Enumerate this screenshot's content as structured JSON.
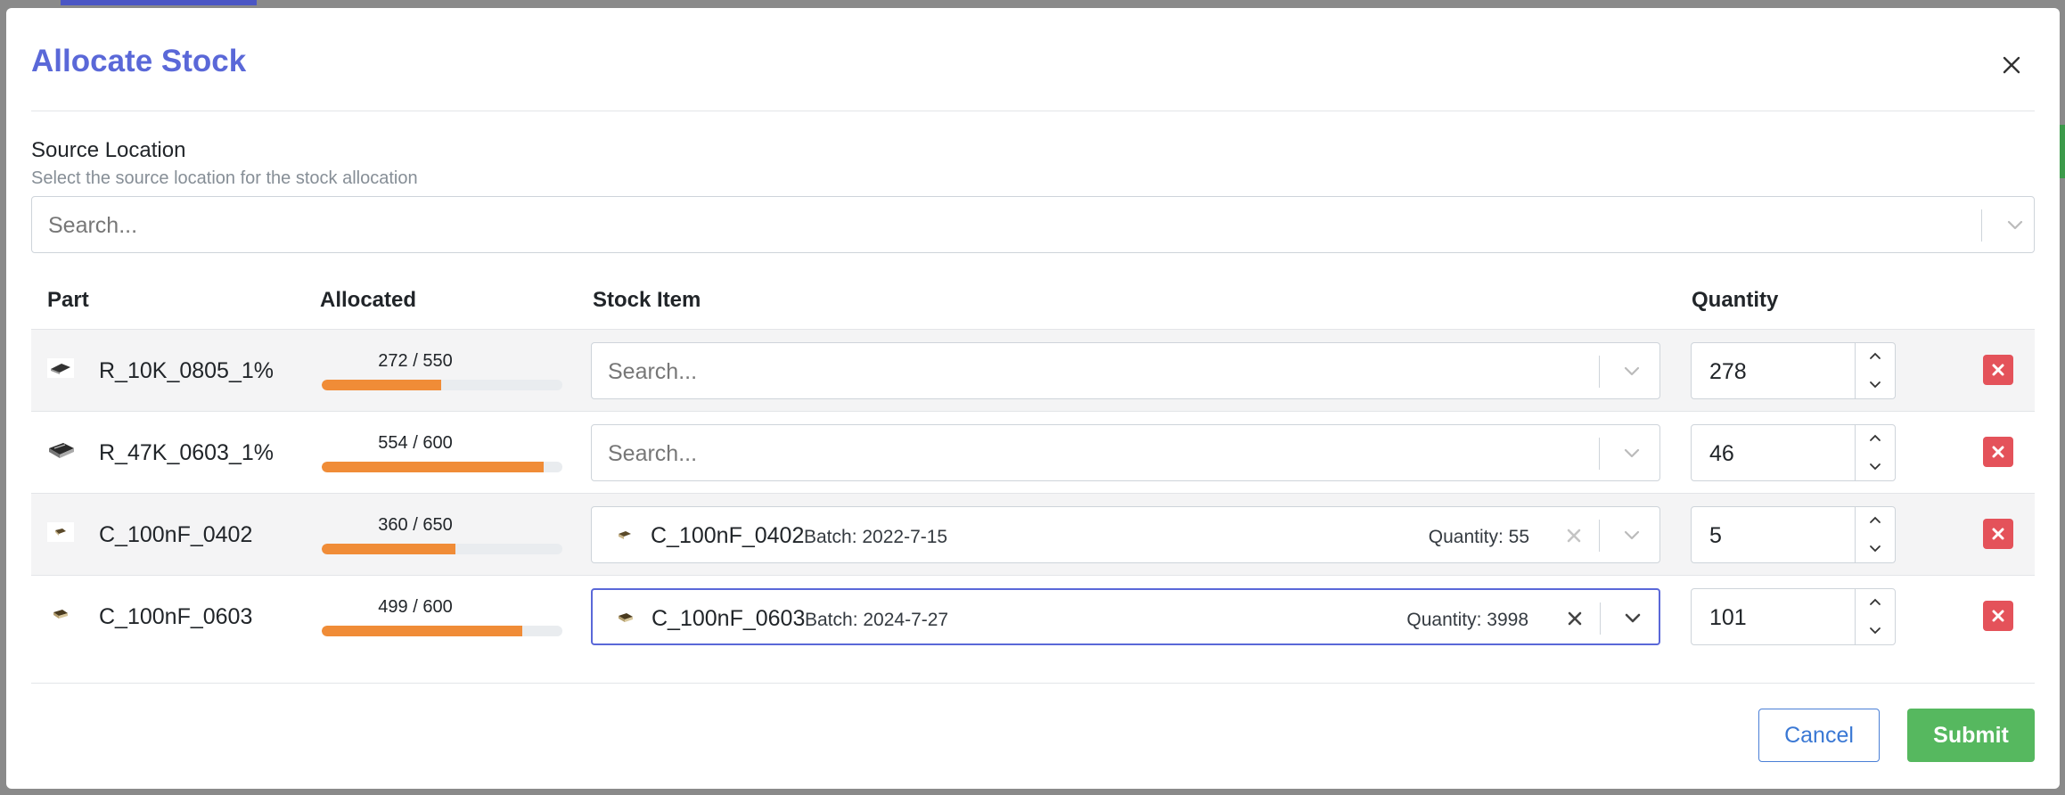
{
  "modal": {
    "title": "Allocate Stock"
  },
  "source": {
    "label": "Source Location",
    "description": "Select the source location for the stock allocation",
    "placeholder": "Search..."
  },
  "table": {
    "headers": {
      "part": "Part",
      "allocated": "Allocated",
      "stock_item": "Stock Item",
      "quantity": "Quantity"
    },
    "rows": [
      {
        "part": "R_10K_0805_1%",
        "allocated_text": "272 / 550",
        "allocated_fraction": 0.4945,
        "stock_placeholder": "Search...",
        "stock_name": "",
        "stock_batch": "",
        "stock_quantity": "",
        "quantity": "278"
      },
      {
        "part": "R_47K_0603_1%",
        "allocated_text": "554 / 600",
        "allocated_fraction": 0.9233,
        "stock_placeholder": "Search...",
        "stock_name": "",
        "stock_batch": "",
        "stock_quantity": "",
        "quantity": "46"
      },
      {
        "part": "C_100nF_0402",
        "allocated_text": "360 / 650",
        "allocated_fraction": 0.5538,
        "stock_placeholder": "",
        "stock_name": "C_100nF_0402",
        "stock_batch": "Batch: 2022-7-15",
        "stock_quantity": "Quantity: 55",
        "quantity": "5"
      },
      {
        "part": "C_100nF_0603",
        "allocated_text": "499 / 600",
        "allocated_fraction": 0.8317,
        "stock_placeholder": "",
        "stock_name": "C_100nF_0603",
        "stock_batch": "Batch: 2024-7-27",
        "stock_quantity": "Quantity: 3998",
        "quantity": "101"
      }
    ]
  },
  "footer": {
    "cancel_label": "Cancel",
    "submit_label": "Submit"
  },
  "colors": {
    "title": "#5a68d8",
    "progress": "#f08c37",
    "delete": "#e4525a",
    "submit": "#56b85f",
    "cancel": "#3a78d4",
    "focus": "#5a68d8"
  },
  "icons": {
    "close": "close-icon",
    "chevron": "chevron-down-icon",
    "clear": "clear-x-icon",
    "delete": "delete-x-icon",
    "stepper_up": "chevron-up-icon",
    "stepper_down": "chevron-down-icon"
  }
}
